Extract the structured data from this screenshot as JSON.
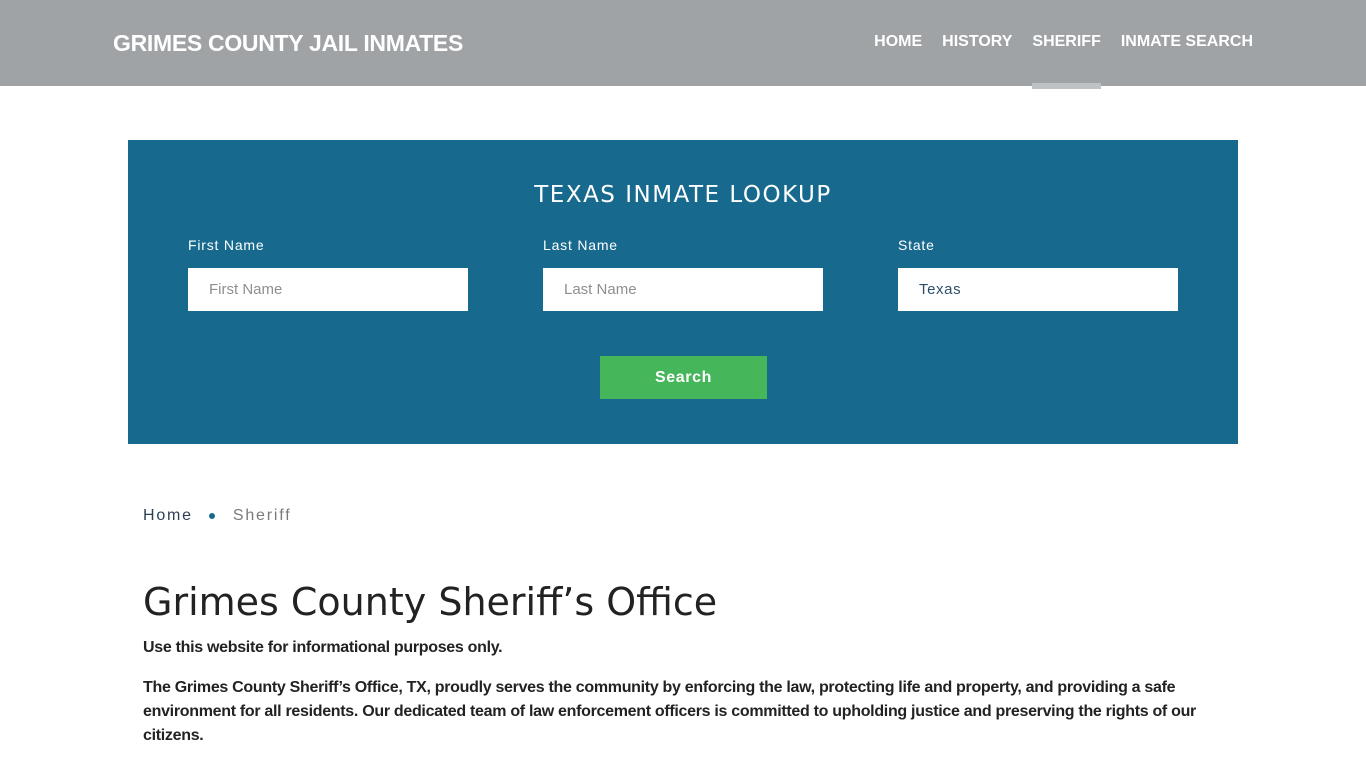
{
  "header": {
    "brand": "GRIMES COUNTY JAIL INMATES",
    "nav": [
      {
        "label": "HOME",
        "active": false
      },
      {
        "label": "HISTORY",
        "active": false
      },
      {
        "label": "SHERIFF",
        "active": true
      },
      {
        "label": "INMATE SEARCH",
        "active": false
      }
    ]
  },
  "lookup": {
    "title": "TEXAS INMATE LOOKUP",
    "first_name": {
      "label": "First Name",
      "placeholder": "First Name",
      "value": ""
    },
    "last_name": {
      "label": "Last Name",
      "placeholder": "Last Name",
      "value": ""
    },
    "state": {
      "label": "State",
      "value": "Texas"
    },
    "search_label": "Search"
  },
  "breadcrumb": {
    "home": "Home",
    "current": "Sheriff"
  },
  "main": {
    "title": "Grimes County Sheriff’s Office",
    "paragraphs": [
      "Use this website for informational purposes only.",
      "The Grimes County Sheriff’s Office, TX, proudly serves the community by enforcing the law, protecting life and property, and providing a safe environment for all residents. Our dedicated team of law enforcement officers is committed to upholding justice and preserving the rights of our citizens."
    ]
  },
  "colors": {
    "header_bg": "#9fa3a6",
    "lookup_bg": "#176a8d",
    "search_button": "#45b659"
  }
}
